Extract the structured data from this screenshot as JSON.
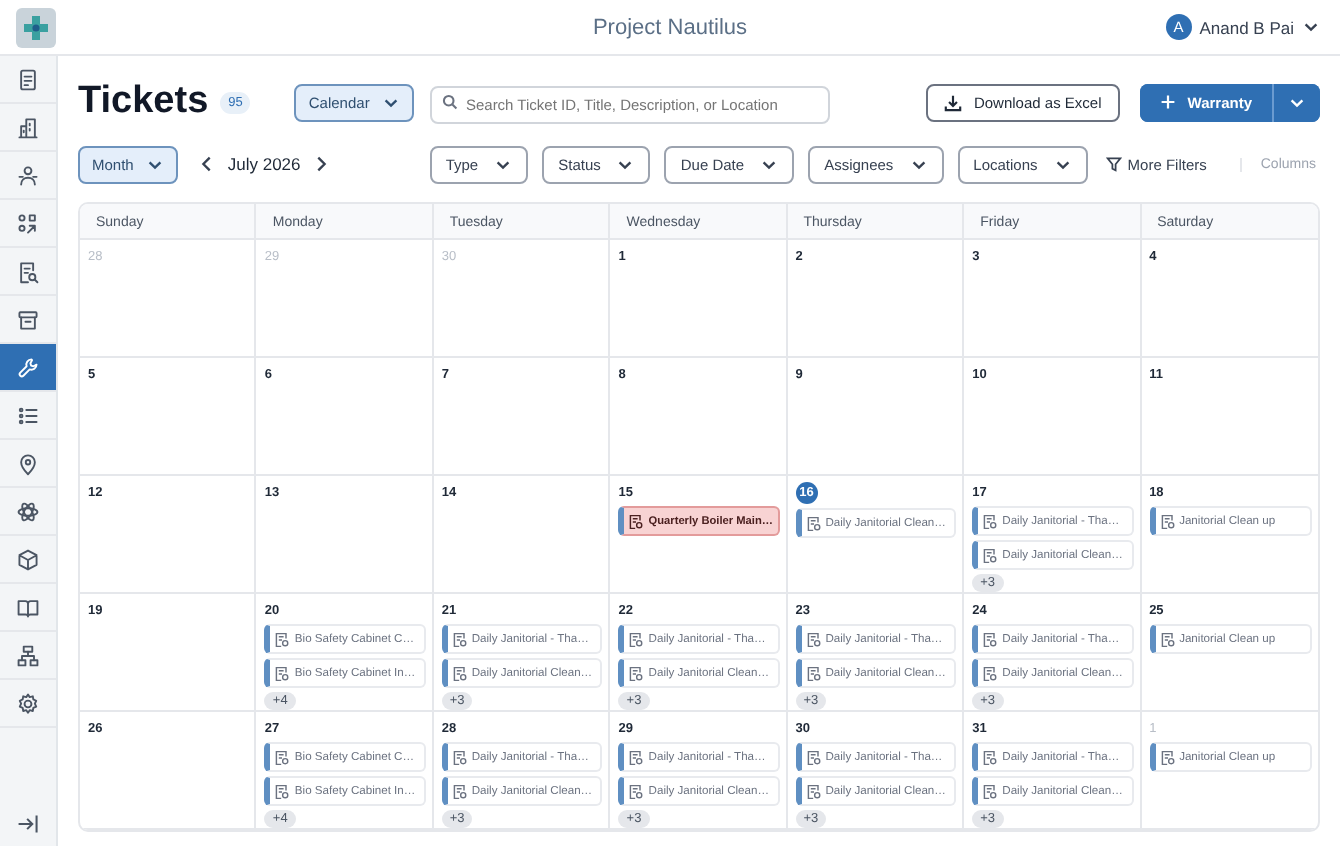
{
  "app": {
    "title": "Project Nautilus",
    "user": {
      "initial": "A",
      "name": "Anand B Pai"
    }
  },
  "sidebar": {
    "items": [
      {
        "kind": "document",
        "selected": false
      },
      {
        "kind": "building",
        "selected": false
      },
      {
        "kind": "people",
        "selected": false
      },
      {
        "kind": "shapes",
        "selected": false
      },
      {
        "kind": "docsearch",
        "selected": false
      },
      {
        "kind": "archive",
        "selected": false
      },
      {
        "kind": "wrench",
        "selected": true
      },
      {
        "kind": "list",
        "selected": false
      },
      {
        "kind": "pin",
        "selected": false
      },
      {
        "kind": "atom",
        "selected": false
      },
      {
        "kind": "cube",
        "selected": false
      },
      {
        "kind": "book",
        "selected": false
      },
      {
        "kind": "sitemap",
        "selected": false
      },
      {
        "kind": "gear",
        "selected": false
      }
    ]
  },
  "header": {
    "title": "Tickets",
    "count": "95",
    "view": "Calendar",
    "search": {
      "placeholder": "Search Ticket ID, Title, Description, or Location"
    },
    "download": "Download as Excel",
    "primary": "Warranty"
  },
  "toolbar": {
    "range": "Month",
    "period": "July 2026",
    "filters": [
      "Type",
      "Status",
      "Due Date",
      "Assignees",
      "Locations"
    ],
    "more_filters": "More Filters",
    "columns": "Columns"
  },
  "calendar": {
    "weekdays": [
      "Sunday",
      "Monday",
      "Tuesday",
      "Wednesday",
      "Thursday",
      "Friday",
      "Saturday"
    ],
    "weeks": [
      [
        {
          "date": "28",
          "outside": true,
          "today": false
        },
        {
          "date": "29",
          "outside": true,
          "today": false
        },
        {
          "date": "30",
          "outside": true,
          "today": false
        },
        {
          "date": "1",
          "outside": false,
          "today": false
        },
        {
          "date": "2",
          "outside": false,
          "today": false
        },
        {
          "date": "3",
          "outside": false,
          "today": false
        },
        {
          "date": "4",
          "outside": false,
          "today": false
        }
      ],
      [
        {
          "date": "5",
          "outside": false,
          "today": false
        },
        {
          "date": "6",
          "outside": false,
          "today": false
        },
        {
          "date": "7",
          "outside": false,
          "today": false
        },
        {
          "date": "8",
          "outside": false,
          "today": false
        },
        {
          "date": "9",
          "outside": false,
          "today": false
        },
        {
          "date": "10",
          "outside": false,
          "today": false
        },
        {
          "date": "11",
          "outside": false,
          "today": false
        }
      ],
      [
        {
          "date": "12",
          "outside": false,
          "today": false
        },
        {
          "date": "13",
          "outside": false,
          "today": false
        },
        {
          "date": "14",
          "outside": false,
          "today": false
        },
        {
          "date": "15",
          "outside": false,
          "today": false,
          "events": [
            {
              "title": "Quarterly Boiler Main…",
              "overdue": true
            }
          ]
        },
        {
          "date": "16",
          "outside": false,
          "today": true,
          "events": [
            {
              "title": "Daily Janitorial Clean…",
              "overdue": false
            }
          ]
        },
        {
          "date": "17",
          "outside": false,
          "today": false,
          "events": [
            {
              "title": "Daily Janitorial - Tha…",
              "overdue": false
            },
            {
              "title": "Daily Janitorial Clean…",
              "overdue": false
            }
          ],
          "more": "+3"
        },
        {
          "date": "18",
          "outside": false,
          "today": false,
          "events": [
            {
              "title": "Janitorial Clean up",
              "overdue": false
            }
          ]
        }
      ],
      [
        {
          "date": "19",
          "outside": false,
          "today": false
        },
        {
          "date": "20",
          "outside": false,
          "today": false,
          "events": [
            {
              "title": "Bio Safety Cabinet C…",
              "overdue": false
            },
            {
              "title": "Bio Safety Cabinet In…",
              "overdue": false
            }
          ],
          "more": "+4"
        },
        {
          "date": "21",
          "outside": false,
          "today": false,
          "events": [
            {
              "title": "Daily Janitorial - Tha…",
              "overdue": false
            },
            {
              "title": "Daily Janitorial Clean…",
              "overdue": false
            }
          ],
          "more": "+3"
        },
        {
          "date": "22",
          "outside": false,
          "today": false,
          "events": [
            {
              "title": "Daily Janitorial - Tha…",
              "overdue": false
            },
            {
              "title": "Daily Janitorial Clean…",
              "overdue": false
            }
          ],
          "more": "+3"
        },
        {
          "date": "23",
          "outside": false,
          "today": false,
          "events": [
            {
              "title": "Daily Janitorial - Tha…",
              "overdue": false
            },
            {
              "title": "Daily Janitorial Clean…",
              "overdue": false
            }
          ],
          "more": "+3"
        },
        {
          "date": "24",
          "outside": false,
          "today": false,
          "events": [
            {
              "title": "Daily Janitorial - Tha…",
              "overdue": false
            },
            {
              "title": "Daily Janitorial Clean…",
              "overdue": false
            }
          ],
          "more": "+3"
        },
        {
          "date": "25",
          "outside": false,
          "today": false,
          "events": [
            {
              "title": "Janitorial Clean up",
              "overdue": false
            }
          ]
        }
      ],
      [
        {
          "date": "26",
          "outside": false,
          "today": false
        },
        {
          "date": "27",
          "outside": false,
          "today": false,
          "events": [
            {
              "title": "Bio Safety Cabinet C…",
              "overdue": false
            },
            {
              "title": "Bio Safety Cabinet In…",
              "overdue": false
            }
          ],
          "more": "+4"
        },
        {
          "date": "28",
          "outside": false,
          "today": false,
          "events": [
            {
              "title": "Daily Janitorial - Tha…",
              "overdue": false
            },
            {
              "title": "Daily Janitorial Clean…",
              "overdue": false
            }
          ],
          "more": "+3"
        },
        {
          "date": "29",
          "outside": false,
          "today": false,
          "events": [
            {
              "title": "Daily Janitorial - Tha…",
              "overdue": false
            },
            {
              "title": "Daily Janitorial Clean…",
              "overdue": false
            }
          ],
          "more": "+3"
        },
        {
          "date": "30",
          "outside": false,
          "today": false,
          "events": [
            {
              "title": "Daily Janitorial - Tha…",
              "overdue": false
            },
            {
              "title": "Daily Janitorial Clean…",
              "overdue": false
            }
          ],
          "more": "+3"
        },
        {
          "date": "31",
          "outside": false,
          "today": false,
          "events": [
            {
              "title": "Daily Janitorial - Tha…",
              "overdue": false
            },
            {
              "title": "Daily Janitorial Clean…",
              "overdue": false
            }
          ],
          "more": "+3"
        },
        {
          "date": "1",
          "outside": true,
          "today": false,
          "events": [
            {
              "title": "Janitorial Clean up",
              "overdue": false
            }
          ]
        }
      ]
    ]
  }
}
